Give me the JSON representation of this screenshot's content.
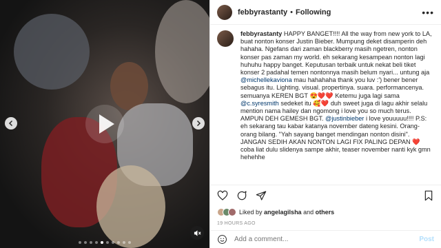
{
  "post": {
    "username": "febbyrastanty",
    "follow_state": "Following",
    "separator": "•",
    "more_label": "•••"
  },
  "caption": {
    "username": "febbyrastanty",
    "p1": "HAPPY BANGET!!!! All the way from new york to LA, buat nonton konser Justin Bieber. Mumpung deket disamperin deh hahaha. Ngefans dari zaman blackberry masih ngetren, nonton konser pas zaman my world. eh sekarang kesampean nonton lagi huhuhu happy banget. Keputusan terbaik untuk nekat beli tiket konser 2 padahal temen nontonnya masih belum nyari... untung aja",
    "m1": "@michellekaviona",
    "p2": "mau hahahaha thank you luv :') bener bener sebagus itu. Lighting. visual. propertinya. suara. performancenya. semuanya KEREN BGT",
    "e1": "😍",
    "e2": "❤️",
    "e3": "❤️",
    "p3": "Ketemu juga lagi sama",
    "m2": "@c.syresmith",
    "p4": "sedeket itu",
    "e4": "🥰",
    "e5": "❤️",
    "p5": "duh sweet juga di lagu akhir selalu mention nama hailey dan ngomong i love you so much terus. AMPUN DEH GEMESH BGT.",
    "m3": "@justinbieber",
    "p6": "i love youuuuu!!!! P.S: eh sekarang tau kabar katanya november dateng kesini. Orang-orang bilang. \"Yah sayang banget mendingan nonton disini\". JANGAN SEDIH AKAN NONTON LAGI FIX PALING DEPAN",
    "e6": "❤️",
    "p7": "coba liat dulu slidenya sampe akhir, teaser november nanti kyk gmn hehehhe"
  },
  "likes": {
    "prefix": "Liked by",
    "user": "angelagilsha",
    "and": "and",
    "others": "others"
  },
  "timestamp": "19 HOURS AGO",
  "comment": {
    "placeholder": "Add a comment...",
    "post_label": "Post"
  },
  "carousel": {
    "slide_count": 10,
    "active_index": 4
  },
  "colors": {
    "link": "#00376b",
    "heart": "#ed4956",
    "post_disabled": "#b2dffc"
  }
}
